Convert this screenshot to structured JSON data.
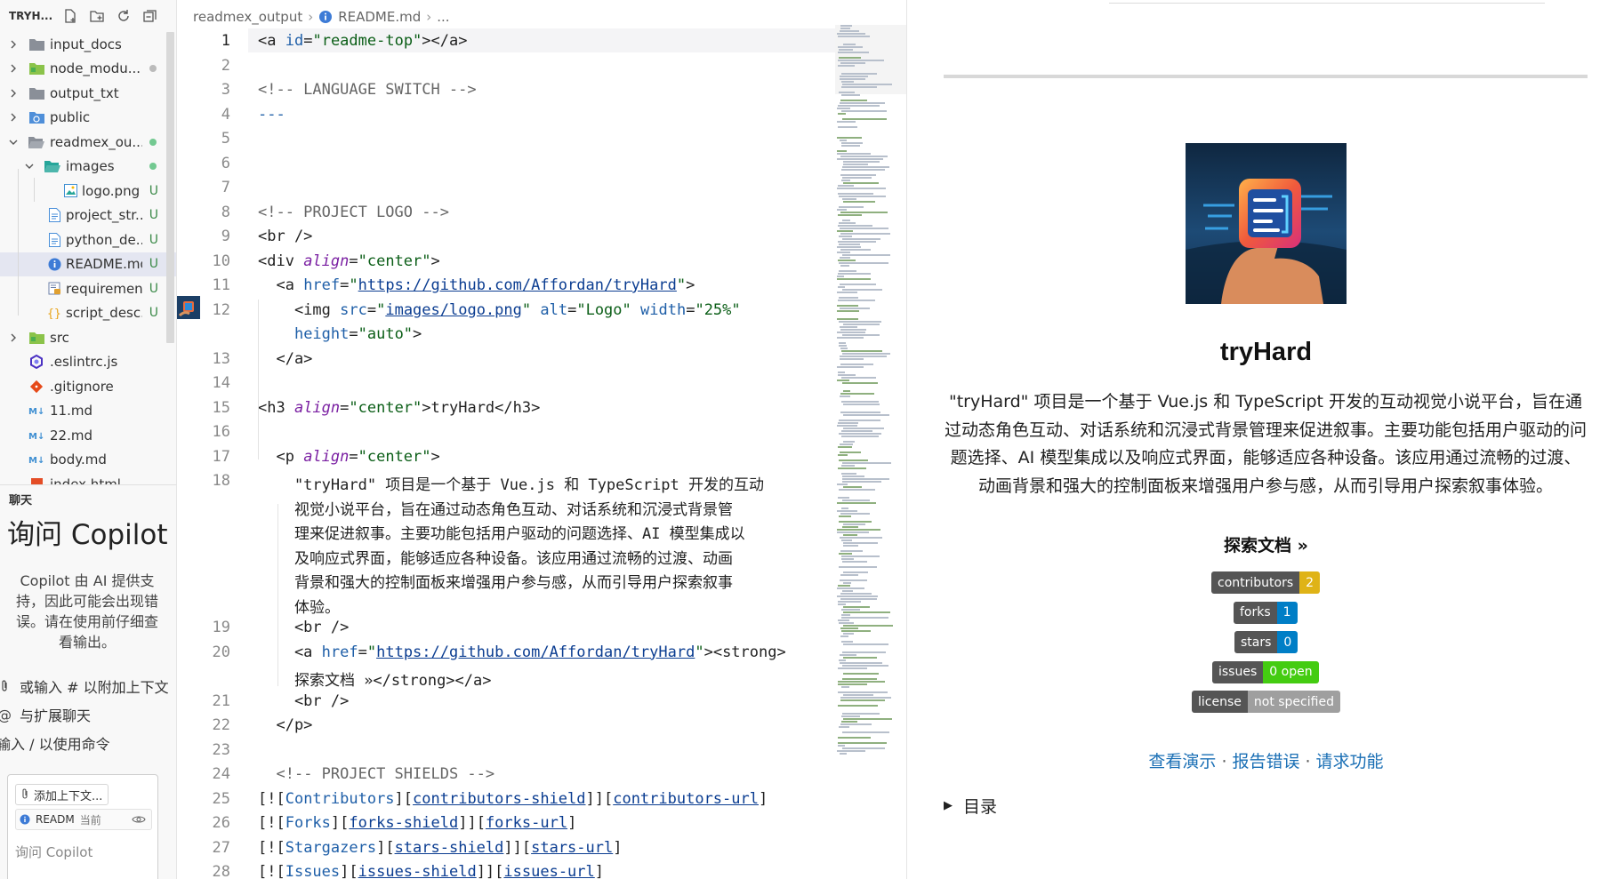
{
  "explorer": {
    "title": "TRYH...",
    "items": [
      {
        "label": "input_docs",
        "kind": "folder",
        "indent": 0,
        "expanded": false,
        "status": ""
      },
      {
        "label": "node_modu...",
        "kind": "folder-green",
        "indent": 0,
        "expanded": false,
        "status": "dot-grey"
      },
      {
        "label": "output_txt",
        "kind": "folder",
        "indent": 0,
        "expanded": false,
        "status": ""
      },
      {
        "label": "public",
        "kind": "folder-blue",
        "indent": 0,
        "expanded": false,
        "status": ""
      },
      {
        "label": "readmex_ou...",
        "kind": "folder-open",
        "indent": 0,
        "expanded": true,
        "status": "dot"
      },
      {
        "label": "images",
        "kind": "folder-open-teal",
        "indent": 1,
        "expanded": true,
        "status": "dot"
      },
      {
        "label": "logo.png",
        "kind": "image",
        "indent": 2,
        "expanded": null,
        "status": "U"
      },
      {
        "label": "project_str...",
        "kind": "doc",
        "indent": 1,
        "expanded": null,
        "status": "U"
      },
      {
        "label": "python_de...",
        "kind": "doc",
        "indent": 1,
        "expanded": null,
        "status": "U"
      },
      {
        "label": "README.md",
        "kind": "info",
        "indent": 1,
        "expanded": null,
        "status": "U",
        "selected": true
      },
      {
        "label": "requiremen...",
        "kind": "py",
        "indent": 1,
        "expanded": null,
        "status": "U"
      },
      {
        "label": "script_desc...",
        "kind": "json",
        "indent": 1,
        "expanded": null,
        "status": "U"
      },
      {
        "label": "src",
        "kind": "folder-green",
        "indent": 0,
        "expanded": false,
        "status": ""
      },
      {
        "label": ".eslintrc.js",
        "kind": "eslint",
        "indent": 0,
        "expanded": null,
        "status": ""
      },
      {
        "label": ".gitignore",
        "kind": "git",
        "indent": 0,
        "expanded": null,
        "status": ""
      },
      {
        "label": "11.md",
        "kind": "md",
        "indent": 0,
        "expanded": null,
        "status": ""
      },
      {
        "label": "22.md",
        "kind": "md",
        "indent": 0,
        "expanded": null,
        "status": ""
      },
      {
        "label": "body.md",
        "kind": "md",
        "indent": 0,
        "expanded": null,
        "status": ""
      },
      {
        "label": "index.html",
        "kind": "html",
        "indent": 0,
        "expanded": null,
        "status": ""
      }
    ]
  },
  "chat": {
    "tab": "聊天",
    "title": "询问 Copilot",
    "disclaimer": "Copilot 由 AI 提供支持，因此可能会出现错误。请在使用前仔细查看输出。",
    "hint_context": "或输入 # 以附加上下文",
    "hint_extensions": "与扩展聊天",
    "hint_commands": "输入 / 以使用命令",
    "add_context": "添加上下文...",
    "current_file": "READM",
    "current_file_tag": "当前",
    "input_placeholder": "询问 Copilot"
  },
  "editor": {
    "breadcrumb": [
      "readmex_output",
      "README.md",
      "..."
    ],
    "active_line": 1,
    "lines": [
      {
        "n": "1",
        "html": "<span class='t-tag'>&lt;a</span> <span class='t-attr'>id</span>=<span class='t-str'>\"readme-top\"</span><span class='t-tag'>&gt;&lt;/a&gt;</span>"
      },
      {
        "n": "2",
        "html": ""
      },
      {
        "n": "3",
        "html": "<span class='t-com'>&lt;!-- LANGUAGE SWITCH --&gt;</span>"
      },
      {
        "n": "4",
        "html": "<span class='t-attr'>---</span>"
      },
      {
        "n": "5",
        "html": ""
      },
      {
        "n": "6",
        "html": ""
      },
      {
        "n": "7",
        "html": ""
      },
      {
        "n": "8",
        "html": "<span class='t-com'>&lt;!-- PROJECT LOGO --&gt;</span>"
      },
      {
        "n": "9",
        "html": "&lt;br /&gt;"
      },
      {
        "n": "10",
        "html": "&lt;div <span class='t-attr-i'>align</span>=<span class='t-str'>\"center\"</span>&gt;"
      },
      {
        "n": "11",
        "html": "  &lt;a <span class='t-attr'>href</span>=<span class='t-str'>\"<span class='t-link'>https://github.com/Affordan/tryHard</span>\"</span>&gt;"
      },
      {
        "n": "12",
        "html": "    &lt;img <span class='t-attr'>src</span>=<span class='t-str'>\"<span class='t-link'>images/logo.png</span>\"</span> <span class='t-attr'>alt</span>=<span class='t-str'>\"Logo\"</span> <span class='t-attr'>width</span>=<span class='t-str'>\"25%\"</span>"
      },
      {
        "n": "",
        "html": "    <span class='t-attr'>height</span>=<span class='t-str'>\"auto\"</span>&gt;"
      },
      {
        "n": "13",
        "html": "  &lt;/a&gt;"
      },
      {
        "n": "14",
        "html": ""
      },
      {
        "n": "15",
        "html": "&lt;h3 <span class='t-attr-i'>align</span>=<span class='t-str'>\"center\"</span>&gt;tryHard&lt;/h3&gt;"
      },
      {
        "n": "16",
        "html": ""
      },
      {
        "n": "17",
        "html": "  &lt;p <span class='t-attr-i'>align</span>=<span class='t-str'>\"center\"</span>&gt;"
      },
      {
        "n": "18",
        "html": "    \"tryHard\" <span class='t-cjk'>项目是一个基于</span> Vue.js <span class='t-cjk'>和</span> TypeScript <span class='t-cjk'>开发的互动</span>"
      },
      {
        "n": "",
        "html": "    <span class='t-cjk'>视觉小说平台，旨在通过动态角色互动、对话系统和沉浸式背景管</span>"
      },
      {
        "n": "",
        "html": "    <span class='t-cjk'>理来促进叙事。主要功能包括用户驱动的问题选择、</span>AI <span class='t-cjk'>模型集成以</span>"
      },
      {
        "n": "",
        "html": "    <span class='t-cjk'>及响应式界面，能够适应各种设备。该应用通过流畅的过渡、动画</span>"
      },
      {
        "n": "",
        "html": "    <span class='t-cjk'>背景和强大的控制面板来增强用户参与感，从而引导用户探索叙事</span>"
      },
      {
        "n": "",
        "html": "    <span class='t-cjk'>体验。</span>"
      },
      {
        "n": "19",
        "html": "    &lt;br /&gt;"
      },
      {
        "n": "20",
        "html": "    &lt;a <span class='t-attr'>href</span>=<span class='t-str'>\"<span class='t-link'>https://github.com/Affordan/tryHard</span>\"</span>&gt;&lt;strong&gt;"
      },
      {
        "n": "",
        "html": "    <span class='t-cjk'>探索文档</span> »&lt;/strong&gt;&lt;/a&gt;"
      },
      {
        "n": "21",
        "html": "    &lt;br /&gt;"
      },
      {
        "n": "22",
        "html": "  &lt;/p&gt;"
      },
      {
        "n": "23",
        "html": ""
      },
      {
        "n": "24",
        "html": "  <span class='t-com'>&lt;!-- PROJECT SHIELDS --&gt;</span>"
      },
      {
        "n": "25",
        "html": "[![<span class='t-attr'>Contributors</span>][<span class='t-link'>contributors-shield</span>]][<span class='t-link'>contributors-url</span>]"
      },
      {
        "n": "26",
        "html": "[![<span class='t-attr'>Forks</span>][<span class='t-link'>forks-shield</span>]][<span class='t-link'>forks-url</span>]"
      },
      {
        "n": "27",
        "html": "[![<span class='t-attr'>Stargazers</span>][<span class='t-link'>stars-shield</span>]][<span class='t-link'>stars-url</span>]"
      },
      {
        "n": "28",
        "html": "[![<span class='t-attr'>Issues</span>][<span class='t-link'>issues-shield</span>]][<span class='t-link'>issues-url</span>]"
      }
    ]
  },
  "preview": {
    "title": "tryHard",
    "description": "\"tryHard\" 项目是一个基于 Vue.js 和 TypeScript 开发的互动视觉小说平台，旨在通过动态角色互动、对话系统和沉浸式背景管理来促进叙事。主要功能包括用户驱动的问题选择、AI 模型集成以及响应式界面，能够适应各种设备。该应用通过流畅的过渡、动画背景和强大的控制面板来增强用户参与感，从而引导用户探索叙事体验。",
    "docs_link": "探索文档 »",
    "badges": [
      {
        "left": "contributors",
        "right": "2",
        "color": "#dfb317"
      },
      {
        "left": "forks",
        "right": "1",
        "color": "#007ec6"
      },
      {
        "left": "stars",
        "right": "0",
        "color": "#007ec6"
      },
      {
        "left": "issues",
        "right": "0 open",
        "color": "#4c1"
      },
      {
        "left": "license",
        "right": "not specified",
        "color": "#9f9f9f"
      }
    ],
    "links": [
      "查看演示",
      "报告错误",
      "请求功能"
    ],
    "link_separator": "·",
    "toc": "目录"
  }
}
